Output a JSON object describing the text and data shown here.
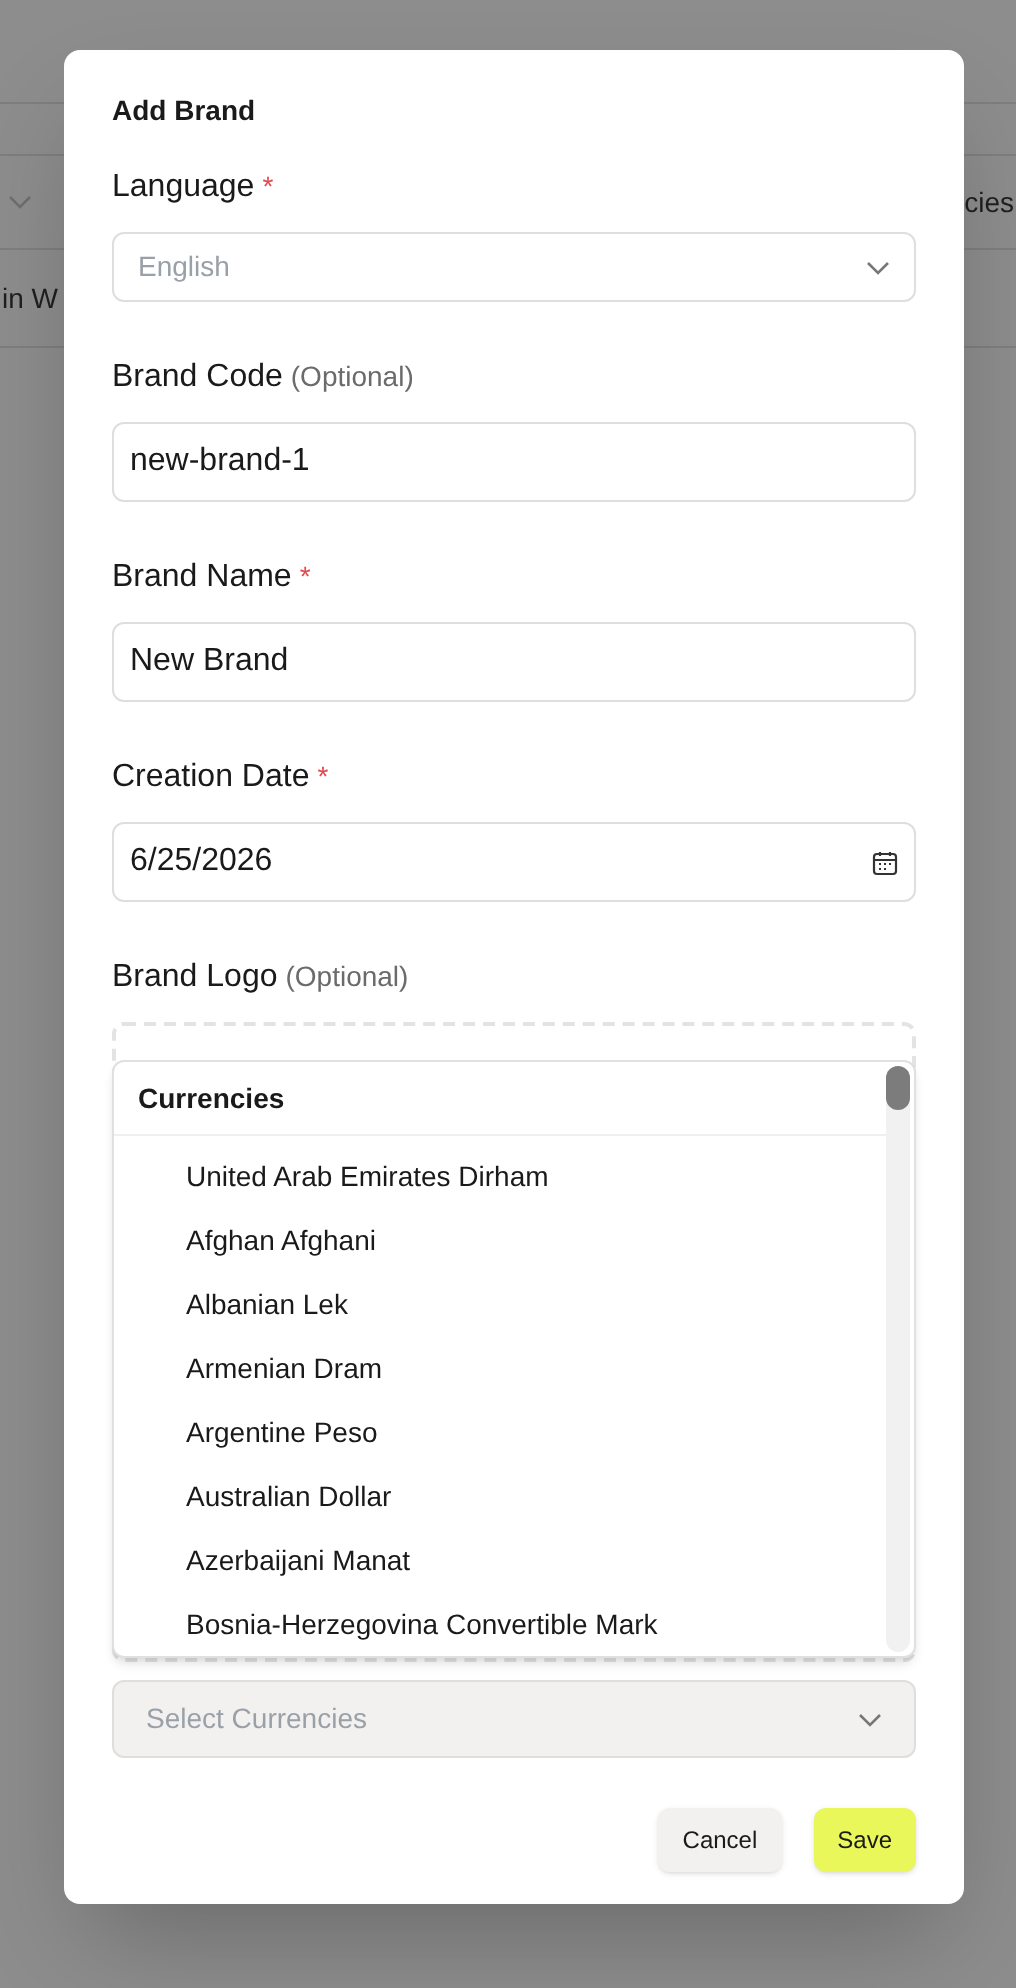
{
  "background": {
    "header_text": "cies",
    "row_text": "in W"
  },
  "dialog": {
    "title": "Add Brand",
    "fields": [
      {
        "kind": "select",
        "label": "Language",
        "required_mark": "*",
        "placeholder": "English"
      },
      {
        "kind": "text",
        "label": "Brand Code",
        "optional_note": "(Optional)",
        "value": "new-brand-1"
      },
      {
        "kind": "text",
        "label": "Brand Name",
        "required_mark": "*",
        "value": "New Brand"
      },
      {
        "kind": "date",
        "label": "Creation Date",
        "required_mark": "*",
        "value": "6/25/2026"
      },
      {
        "kind": "upload",
        "label": "Brand Logo",
        "optional_note": "(Optional)"
      }
    ],
    "currency_select": {
      "placeholder": "Select Currencies",
      "disabled": true
    },
    "dropdown": {
      "heading": "Currencies",
      "options": [
        {
          "label": "United Arab Emirates Dirham",
          "selected": false
        },
        {
          "label": "Afghan Afghani",
          "selected": false
        },
        {
          "label": "Albanian Lek",
          "selected": false
        },
        {
          "label": "Armenian Dram",
          "selected": false
        },
        {
          "label": "Argentine Peso",
          "selected": false
        },
        {
          "label": "Australian Dollar",
          "selected": false
        },
        {
          "label": "Azerbaijani Manat",
          "selected": false
        },
        {
          "label": "Bosnia-Herzegovina Convertible Mark",
          "selected": false
        }
      ]
    },
    "buttons": [
      {
        "kind": "secondary",
        "label": "Cancel"
      },
      {
        "kind": "primary",
        "label": "Save"
      }
    ]
  }
}
